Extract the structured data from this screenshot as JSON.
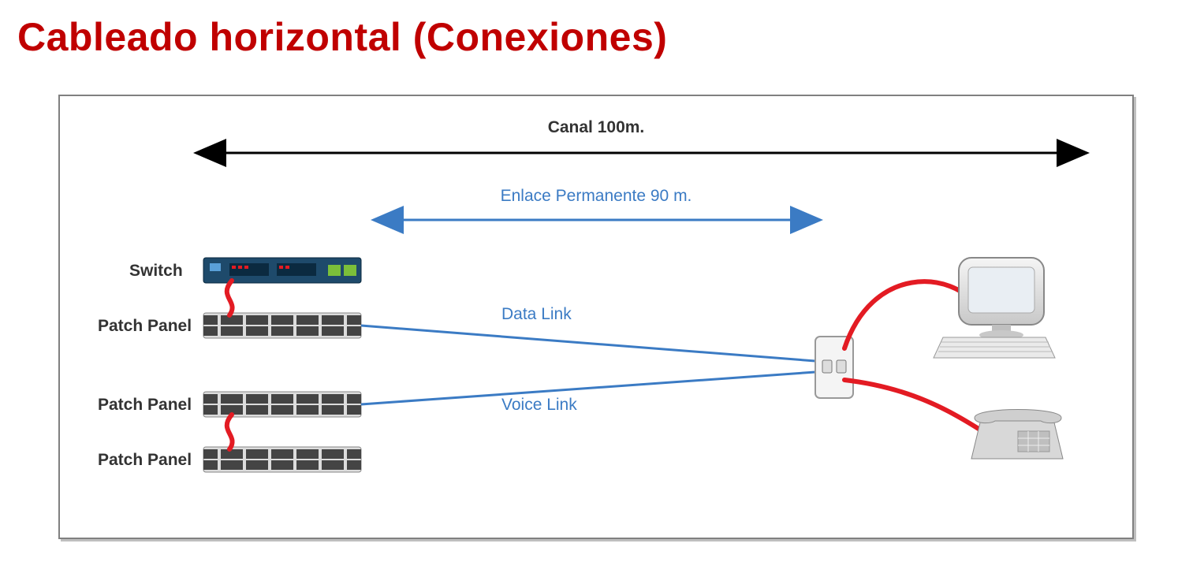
{
  "title": "Cableado horizontal (Conexiones)",
  "channel_label": "Canal 100m.",
  "permanent_link_label": "Enlace Permanente 90 m.",
  "data_link_label": "Data Link",
  "voice_link_label": "Voice Link",
  "switch_label": "Switch",
  "patch_panel_label": "Patch Panel",
  "colors": {
    "title": "#c00000",
    "blue": "#3b7bc4",
    "red_cable": "#e31b23",
    "black": "#000000",
    "gray": "#808080"
  }
}
